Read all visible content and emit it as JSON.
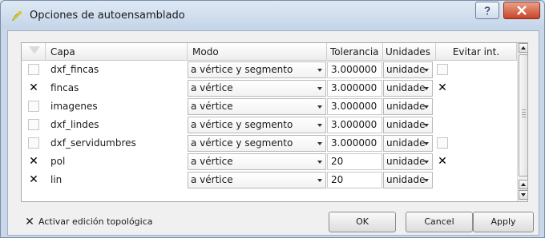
{
  "window": {
    "title": "Opciones de autoensamblado",
    "accent": "#c8452a"
  },
  "table": {
    "headers": {
      "capa": "Capa",
      "modo": "Modo",
      "tolerancia": "Tolerancia",
      "unidades": "Unidades",
      "evitar": "Evitar int."
    },
    "rows": [
      {
        "checked": false,
        "capa": "dxf_fincas",
        "modo": "a vértice y segmento",
        "tolerancia": "3.000000",
        "unidades": "unidade",
        "evitar": false
      },
      {
        "checked": true,
        "capa": "fincas",
        "modo": "a vértice",
        "tolerancia": "3.000000",
        "unidades": "unidade",
        "evitar": true
      },
      {
        "checked": false,
        "capa": "imagenes",
        "modo": "a vértice",
        "tolerancia": "3.000000",
        "unidades": "unidade",
        "evitar": null
      },
      {
        "checked": false,
        "capa": "dxf_lindes",
        "modo": "a vértice y segmento",
        "tolerancia": "3.000000",
        "unidades": "unidade",
        "evitar": null
      },
      {
        "checked": false,
        "capa": "dxf_servidumbres",
        "modo": "a vértice y segmento",
        "tolerancia": "3.000000",
        "unidades": "unidade",
        "evitar": false
      },
      {
        "checked": true,
        "capa": "pol",
        "modo": "a vértice",
        "tolerancia": "20",
        "unidades": "unidade",
        "evitar": true
      },
      {
        "checked": true,
        "capa": "lin",
        "modo": "a vértice",
        "tolerancia": "20",
        "unidades": "unidade",
        "evitar": null
      }
    ]
  },
  "footer": {
    "topo_checked": true,
    "topo_label": "Activar edición topológica",
    "ok_label": "OK",
    "cancel_label": "Cancel",
    "apply_label": "Apply"
  }
}
